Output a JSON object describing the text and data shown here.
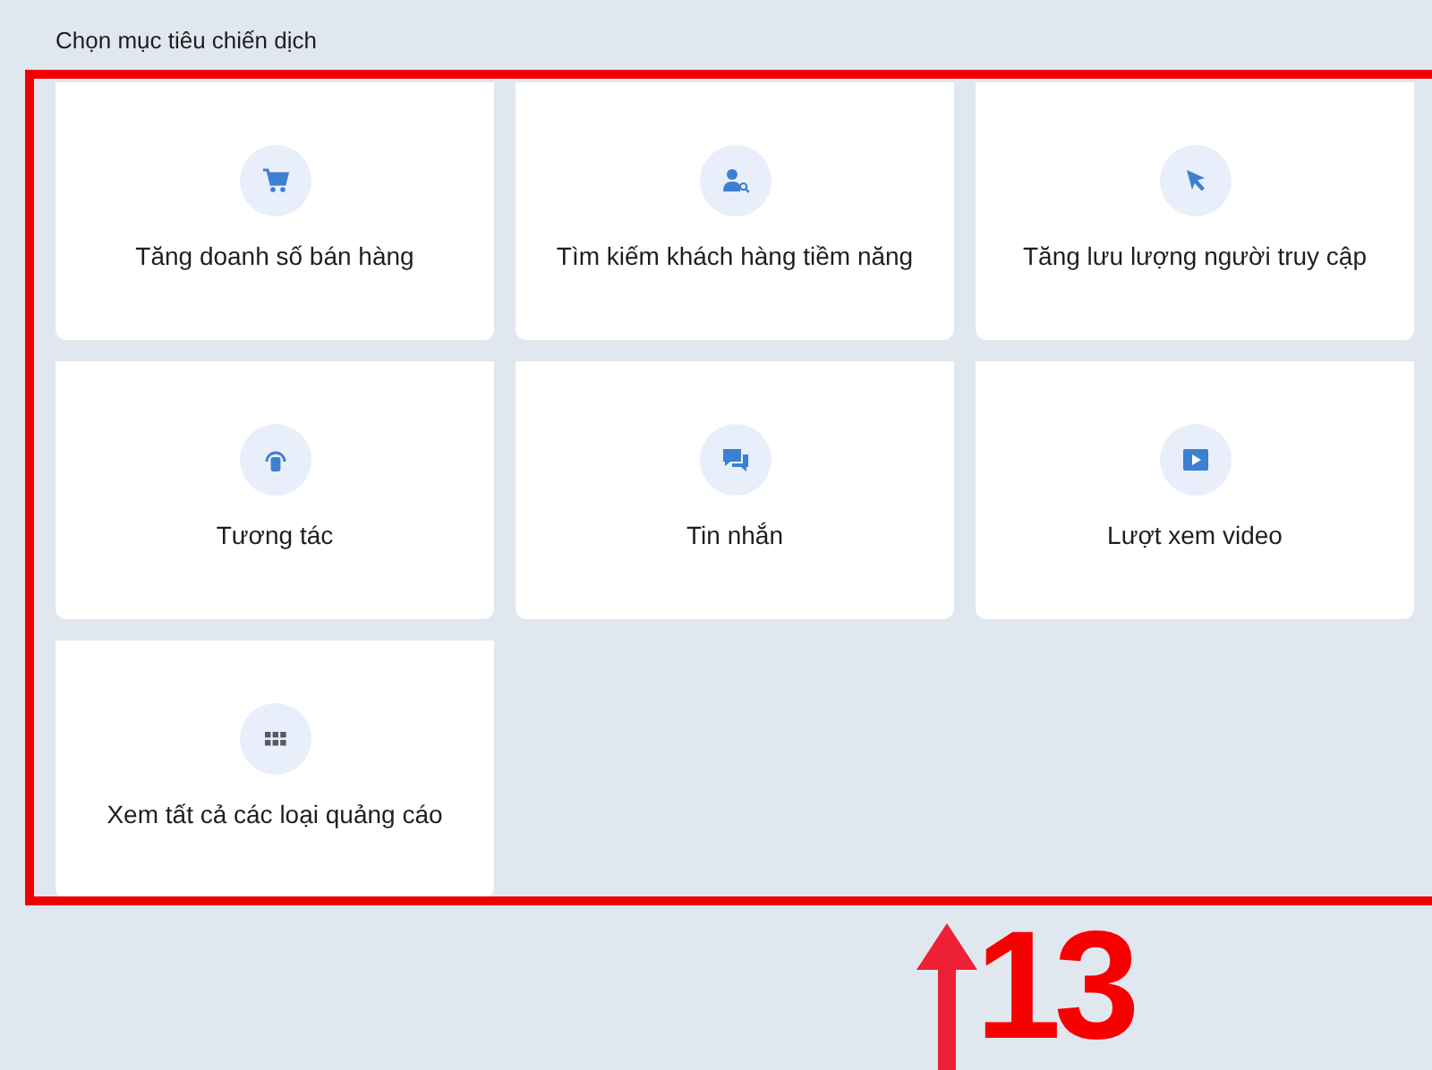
{
  "heading": "Chọn mục tiêu chiến dịch",
  "objectives": [
    {
      "label": "Tăng doanh số bán hàng",
      "kind": "cart"
    },
    {
      "label": "Tìm kiếm khách hàng tiềm năng",
      "kind": "usersearch"
    },
    {
      "label": "Tăng lưu lượng người truy cập",
      "kind": "cursor"
    },
    {
      "label": "Tương tác",
      "kind": "engagement"
    },
    {
      "label": "Tin nhắn",
      "kind": "messages"
    },
    {
      "label": "Lượt xem video",
      "kind": "video"
    },
    {
      "label": "Xem tất cả các loại quảng cáo",
      "kind": "grid"
    }
  ],
  "annotation": {
    "number": "13"
  }
}
